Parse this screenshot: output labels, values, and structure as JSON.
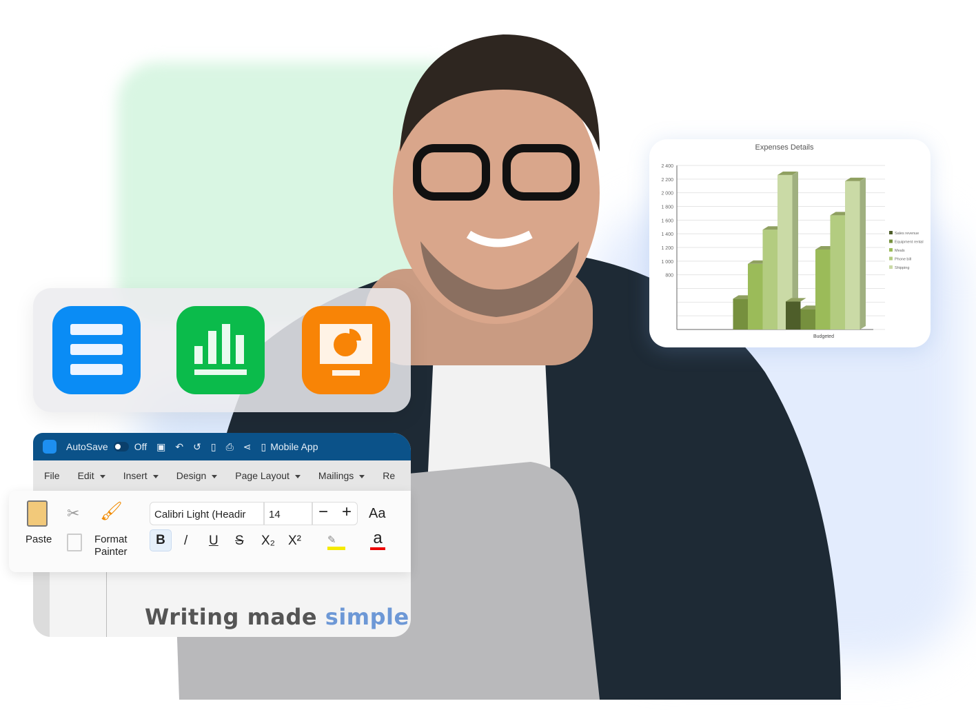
{
  "apps": [
    {
      "name": "writer",
      "color": "#0a8cf5"
    },
    {
      "name": "spreadsheets",
      "color": "#0bbb4b"
    },
    {
      "name": "presentation",
      "color": "#f88406"
    }
  ],
  "word": {
    "titlebar": {
      "autosave": "AutoSave",
      "autosave_state": "Off",
      "mobile": "Mobile App"
    },
    "menu": [
      "File",
      "Edit",
      "Insert",
      "Design",
      "Page Layout",
      "Mailings",
      "Re"
    ],
    "ribbon": {
      "paste": "Paste",
      "format_painter_1": "Format",
      "format_painter_2": "Painter",
      "font": "Calibri Light (Headir",
      "size": "14",
      "minus": "−",
      "plus": "+",
      "case": "Aa",
      "bold": "B",
      "italic": "/",
      "underline": "U",
      "strike": "S",
      "sub": "X₂",
      "sup": "X²",
      "fontcolor": "a"
    },
    "tagline": {
      "a": "Writing made ",
      "b": "simple"
    }
  },
  "chart_data": {
    "type": "bar",
    "title": "Expenses Details",
    "categories": [
      "",
      "Budgeted"
    ],
    "series": [
      {
        "name": "Sales revenue",
        "color": "#4e5e2a",
        "values": [
          null,
          410
        ]
      },
      {
        "name": "Equipment rental",
        "color": "#76903e",
        "values": [
          450,
          300
        ]
      },
      {
        "name": "Meals",
        "color": "#9bbb59",
        "values": [
          960,
          1170
        ]
      },
      {
        "name": "Phone bill",
        "color": "#b3cc80",
        "values": [
          1460,
          1670
        ]
      },
      {
        "name": "Shipping",
        "color": "#cadaa6",
        "values": [
          2260,
          2170
        ]
      }
    ],
    "yticks": [
      "800",
      "1 000",
      "1 200",
      "1 400",
      "1 600",
      "1 800",
      "2 000",
      "2 200",
      "2 400"
    ],
    "ylim": [
      0,
      2400
    ],
    "grid": true,
    "legend": "right"
  }
}
